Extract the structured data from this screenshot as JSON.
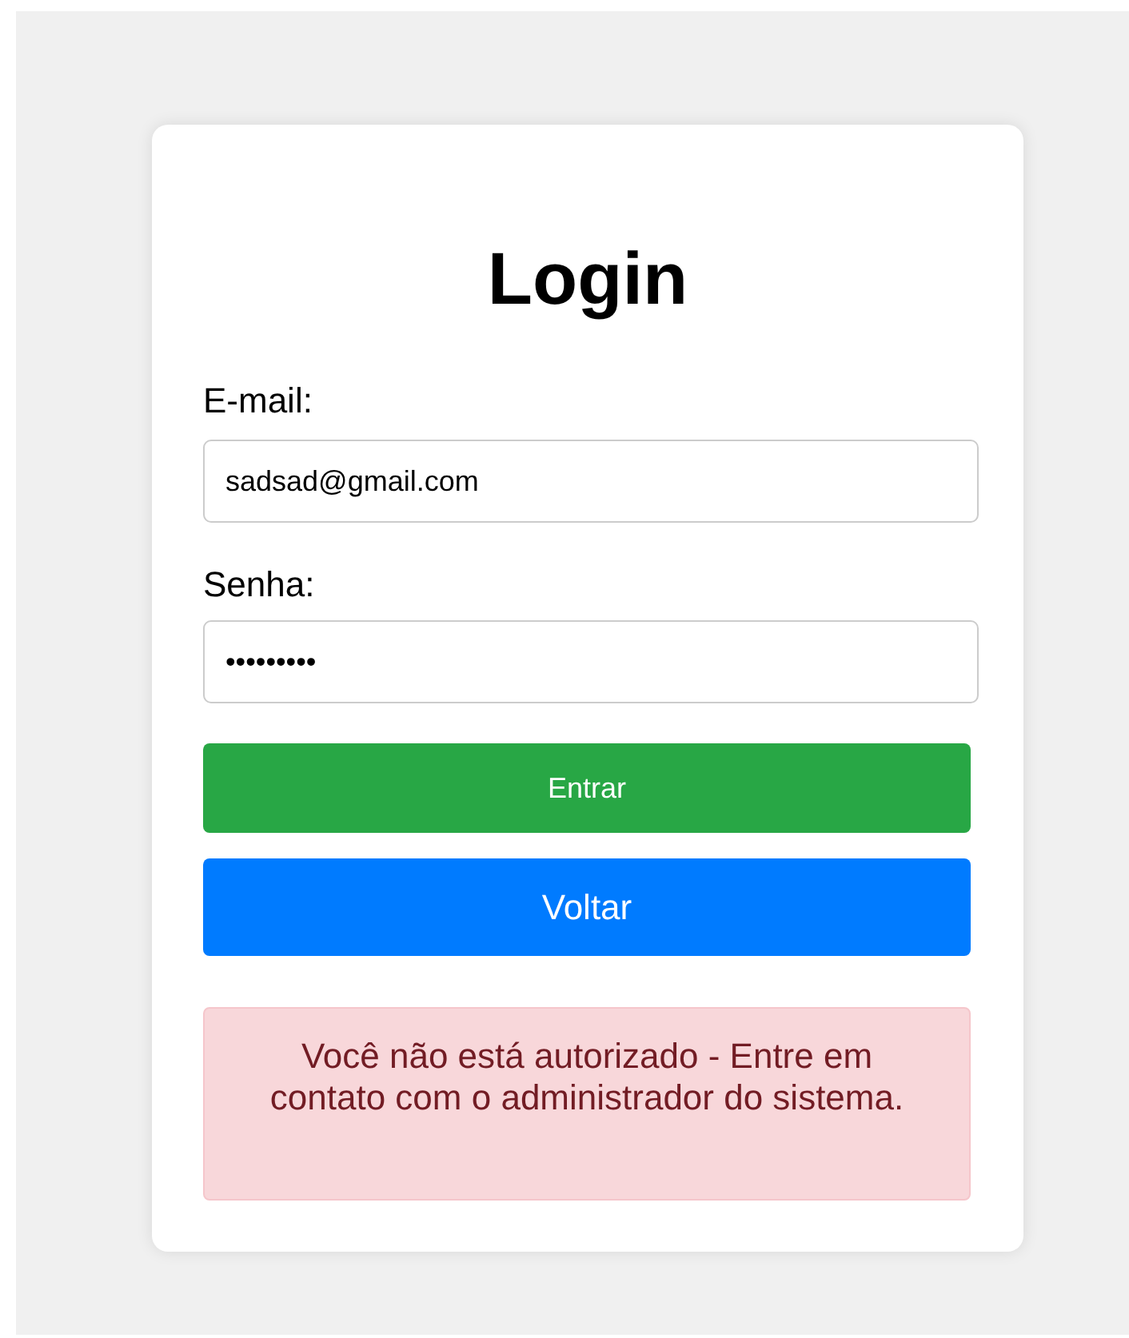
{
  "title": "Login",
  "fields": [
    {
      "label": "E-mail:",
      "value": "sadsad@gmail.com"
    },
    {
      "label": "Senha:",
      "value": "•••••••••"
    }
  ],
  "buttons": [
    {
      "label": "Entrar",
      "kind": "primary"
    },
    {
      "label": "Voltar",
      "kind": "secondary"
    }
  ],
  "alert": {
    "text": "Você não está autorizado - Entre em contato com o administrador do sistema."
  }
}
